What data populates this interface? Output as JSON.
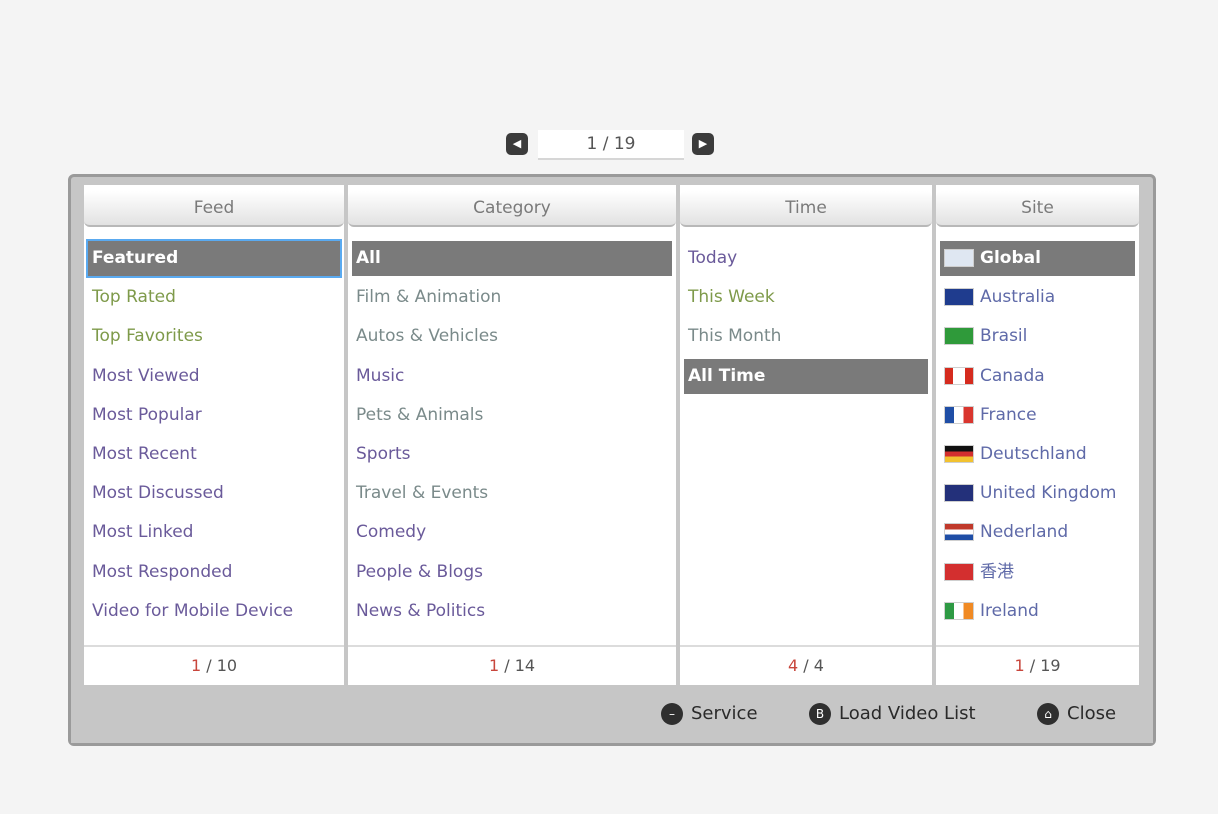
{
  "pager": {
    "text": "1 / 19",
    "prev_icon": "arrow-left-icon",
    "next_icon": "arrow-right-icon"
  },
  "columns": {
    "feed": {
      "header": "Feed",
      "items": [
        "Featured",
        "Top Rated",
        "Top Favorites",
        "Most Viewed",
        "Most Popular",
        "Most Recent",
        "Most Discussed",
        "Most Linked",
        "Most Responded",
        "Video for Mobile Device"
      ],
      "page_current": "1",
      "page_total": " / 10"
    },
    "category": {
      "header": "Category",
      "items": [
        "All",
        "Film & Animation",
        "Autos & Vehicles",
        "Music",
        "Pets & Animals",
        "Sports",
        "Travel & Events",
        "Comedy",
        "People & Blogs",
        "News & Politics"
      ],
      "page_current": "1",
      "page_total": " / 14"
    },
    "time": {
      "header": "Time",
      "items": [
        "Today",
        "This Week",
        "This Month",
        "All Time"
      ],
      "page_current": "4",
      "page_total": " / 4"
    },
    "site": {
      "header": "Site",
      "items": [
        "Global",
        "Australia",
        "Brasil",
        "Canada",
        "France",
        "Deutschland",
        "United Kingdom",
        "Nederland",
        "香港",
        "Ireland"
      ],
      "page_current": "1",
      "page_total": " / 19"
    }
  },
  "footer": {
    "service": "Service",
    "load": "Load Video List",
    "close": "Close"
  },
  "colors": {
    "selected_bg": "#7a7a7a",
    "page_current": "#c8463c",
    "panel_bg": "#c6c6c6"
  }
}
